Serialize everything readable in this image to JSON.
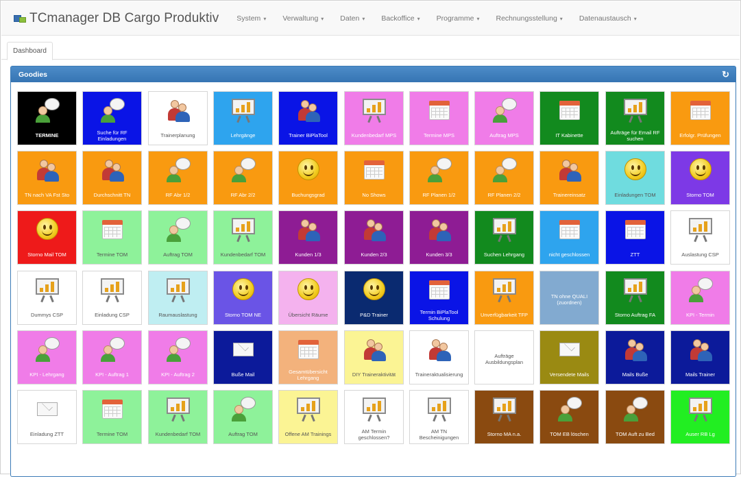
{
  "app": {
    "title": "TCmanager DB Cargo Produktiv"
  },
  "menu": [
    "System",
    "Verwaltung",
    "Daten",
    "Backoffice",
    "Programme",
    "Rechnungsstellung",
    "Datenaustausch"
  ],
  "tabs": [
    {
      "label": "Dashboard"
    }
  ],
  "panel": {
    "title": "Goodies"
  },
  "colors": {
    "black": "#000000",
    "blue": "#0a14e6",
    "white": "#ffffff",
    "sky": "#2ea4ee",
    "pink": "#f07ce8",
    "green": "#128a1e",
    "orange": "#f99a10",
    "teal": "#6fdcdf",
    "violet": "#7d39e6",
    "red": "#ee1a1a",
    "lightgreen": "#8ef29a",
    "purple": "#8e1c94",
    "navy": "#0d3a8c",
    "pale": "#bfeef2",
    "mid": "#6a54e6",
    "lightpink": "#f4b2ee",
    "darkblue": "#0a2a70",
    "deepnavy": "#0c1a9a",
    "peach": "#f3b27c",
    "yellow": "#fbf494",
    "olive": "#9a8a12",
    "brown": "#8a4a10",
    "lime": "#22ee22",
    "steel": "#82aad0"
  },
  "tiles": [
    [
      {
        "label": "TERMINE",
        "icon": "chat-icon",
        "bg": "#000000",
        "fg": "#ffffff",
        "bold": true
      },
      {
        "label": "Suche für RF Einladungen",
        "icon": "chat-icon",
        "bg": "#0a14e6",
        "fg": "#ffffff"
      },
      {
        "label": "Trainerplanung",
        "icon": "people-icon",
        "bg": "#ffffff",
        "fg": "#555555"
      },
      {
        "label": "Lehrgänge",
        "icon": "board-icon",
        "bg": "#2ea4ee",
        "fg": "#ffffff"
      },
      {
        "label": "Trainer BiPlaTool",
        "icon": "people-icon",
        "bg": "#0a14e6",
        "fg": "#ffffff"
      },
      {
        "label": "Kundenbedarf MPS",
        "icon": "board-icon",
        "bg": "#f07ce8",
        "fg": "#ffffff"
      },
      {
        "label": "Termine MPS",
        "icon": "calendar-icon",
        "bg": "#f07ce8",
        "fg": "#ffffff"
      },
      {
        "label": "Auftrag MPS",
        "icon": "chat-icon",
        "bg": "#f07ce8",
        "fg": "#ffffff"
      },
      {
        "label": "IT Kabinette",
        "icon": "calendar-icon",
        "bg": "#128a1e",
        "fg": "#ffffff"
      },
      {
        "label": "Aufträge für Email RF suchen",
        "icon": "board-icon",
        "bg": "#128a1e",
        "fg": "#ffffff"
      },
      {
        "label": "Erfolgr. Prüfungen",
        "icon": "calendar-icon",
        "bg": "#f99a10",
        "fg": "#ffffff"
      }
    ],
    [
      {
        "label": "TN nach VA Fst Sto",
        "icon": "people-icon",
        "bg": "#f99a10",
        "fg": "#ffffff"
      },
      {
        "label": "Durchschnitt TN",
        "icon": "people-icon",
        "bg": "#f99a10",
        "fg": "#ffffff"
      },
      {
        "label": "RF Abr 1/2",
        "icon": "chat-icon",
        "bg": "#f99a10",
        "fg": "#ffffff"
      },
      {
        "label": "RF Abr 2/2",
        "icon": "chat-icon",
        "bg": "#f99a10",
        "fg": "#ffffff"
      },
      {
        "label": "Buchungsgrad",
        "icon": "smile-icon",
        "bg": "#f99a10",
        "fg": "#ffffff"
      },
      {
        "label": "No Shows",
        "icon": "calendar-icon",
        "bg": "#f99a10",
        "fg": "#ffffff"
      },
      {
        "label": "RF Planen 1/2",
        "icon": "chat-icon",
        "bg": "#f99a10",
        "fg": "#ffffff"
      },
      {
        "label": "RF Planen 2/2",
        "icon": "chat-icon",
        "bg": "#f99a10",
        "fg": "#ffffff"
      },
      {
        "label": "Trainereinsatz",
        "icon": "people-icon",
        "bg": "#f99a10",
        "fg": "#ffffff"
      },
      {
        "label": "Einladungen TOM",
        "icon": "smile-icon",
        "bg": "#6fdcdf",
        "fg": "#555555"
      },
      {
        "label": "Storno TOM",
        "icon": "smile-icon",
        "bg": "#7d39e6",
        "fg": "#ffffff"
      }
    ],
    [
      {
        "label": "Storno Mail TOM",
        "icon": "smile-icon",
        "bg": "#ee1a1a",
        "fg": "#ffffff"
      },
      {
        "label": "Termine TOM",
        "icon": "calendar-icon",
        "bg": "#8ef29a",
        "fg": "#555555"
      },
      {
        "label": "Auftrag TOM",
        "icon": "chat-icon",
        "bg": "#8ef29a",
        "fg": "#555555"
      },
      {
        "label": "Kundenbedarf TOM",
        "icon": "board-icon",
        "bg": "#8ef29a",
        "fg": "#555555"
      },
      {
        "label": "Kunden 1/3",
        "icon": "people-icon",
        "bg": "#8e1c94",
        "fg": "#ffffff"
      },
      {
        "label": "Kunden 2/3",
        "icon": "people-icon",
        "bg": "#8e1c94",
        "fg": "#ffffff"
      },
      {
        "label": "Kunden 3/3",
        "icon": "people-icon",
        "bg": "#8e1c94",
        "fg": "#ffffff"
      },
      {
        "label": "Suchen Lehrgang",
        "icon": "board-icon",
        "bg": "#128a1e",
        "fg": "#ffffff"
      },
      {
        "label": "nicht geschlossen",
        "icon": "calendar-icon",
        "bg": "#2ea4ee",
        "fg": "#ffffff"
      },
      {
        "label": "ZTT",
        "icon": "calendar-icon",
        "bg": "#0a14e6",
        "fg": "#ffffff"
      },
      {
        "label": "Auslastung CSP",
        "icon": "board-icon",
        "bg": "#ffffff",
        "fg": "#555555"
      }
    ],
    [
      {
        "label": "Dummys CSP",
        "icon": "board-icon",
        "bg": "#ffffff",
        "fg": "#555555"
      },
      {
        "label": "Einladung CSP",
        "icon": "board-icon",
        "bg": "#ffffff",
        "fg": "#555555"
      },
      {
        "label": "Raumauslastung",
        "icon": "board-icon",
        "bg": "#bfeef2",
        "fg": "#555555"
      },
      {
        "label": "Storno TOM NE",
        "icon": "smile-icon",
        "bg": "#6a54e6",
        "fg": "#ffffff"
      },
      {
        "label": "Übersicht Räume",
        "icon": "smile-icon",
        "bg": "#f4b2ee",
        "fg": "#555555"
      },
      {
        "label": "P&D Trainer",
        "icon": "smile-icon",
        "bg": "#0a2a70",
        "fg": "#ffffff"
      },
      {
        "label": "Termin BiPlaTool Schulung",
        "icon": "calendar-icon",
        "bg": "#0a14e6",
        "fg": "#ffffff"
      },
      {
        "label": "Unverfügbarkeit TFP",
        "icon": "board-icon",
        "bg": "#f99a10",
        "fg": "#ffffff"
      },
      {
        "label": "TN ohne QUALI (zuordnen)",
        "icon": "",
        "bg": "#82aad0",
        "fg": "#ffffff"
      },
      {
        "label": "Storno Auftrag FA",
        "icon": "board-icon",
        "bg": "#128a1e",
        "fg": "#ffffff"
      },
      {
        "label": "KPI - Termin",
        "icon": "chat-icon",
        "bg": "#f07ce8",
        "fg": "#ffffff"
      }
    ],
    [
      {
        "label": "KPI - Lehrgang",
        "icon": "chat-icon",
        "bg": "#f07ce8",
        "fg": "#ffffff"
      },
      {
        "label": "KPI - Auftrag 1",
        "icon": "chat-icon",
        "bg": "#f07ce8",
        "fg": "#ffffff"
      },
      {
        "label": "KPI - Auftrag 2",
        "icon": "chat-icon",
        "bg": "#f07ce8",
        "fg": "#ffffff"
      },
      {
        "label": "Buße Mail",
        "icon": "mail-icon",
        "bg": "#0c1a9a",
        "fg": "#ffffff"
      },
      {
        "label": "Gesamtübersicht Lehrgang",
        "icon": "calendar-icon",
        "bg": "#f3b27c",
        "fg": "#ffffff"
      },
      {
        "label": "DIY Traineraktivität",
        "icon": "people-icon",
        "bg": "#fbf494",
        "fg": "#555555"
      },
      {
        "label": "Traineraktualisierung",
        "icon": "people-icon",
        "bg": "#ffffff",
        "fg": "#555555"
      },
      {
        "label": "Aufträge Ausbildungsplan",
        "icon": "",
        "bg": "#ffffff",
        "fg": "#555555"
      },
      {
        "label": "Versendete Mails",
        "icon": "mail-icon",
        "bg": "#9a8a12",
        "fg": "#ffffff"
      },
      {
        "label": "Mails Buße",
        "icon": "people-icon",
        "bg": "#0c1a9a",
        "fg": "#ffffff"
      },
      {
        "label": "Mails Trainer",
        "icon": "people-icon",
        "bg": "#0c1a9a",
        "fg": "#ffffff"
      }
    ],
    [
      {
        "label": "Einladung ZTT",
        "icon": "mail-icon",
        "bg": "#ffffff",
        "fg": "#555555"
      },
      {
        "label": "Termine TOM",
        "icon": "calendar-icon",
        "bg": "#8ef29a",
        "fg": "#555555"
      },
      {
        "label": "Kundenbedarf TOM",
        "icon": "board-icon",
        "bg": "#8ef29a",
        "fg": "#555555"
      },
      {
        "label": "Auftrag TOM",
        "icon": "chat-icon",
        "bg": "#8ef29a",
        "fg": "#555555"
      },
      {
        "label": "Offene AM Trainings",
        "icon": "board-icon",
        "bg": "#fbf494",
        "fg": "#555555"
      },
      {
        "label": "AM Termin geschlossen?",
        "icon": "board-icon",
        "bg": "#ffffff",
        "fg": "#555555"
      },
      {
        "label": "AM TN Bescheinigungen",
        "icon": "board-icon",
        "bg": "#ffffff",
        "fg": "#555555"
      },
      {
        "label": "Storno MA n.a.",
        "icon": "board-icon",
        "bg": "#8a4a10",
        "fg": "#ffffff"
      },
      {
        "label": "TOM EB löschen",
        "icon": "chat-icon",
        "bg": "#8a4a10",
        "fg": "#ffffff"
      },
      {
        "label": "TOM Auft zu Bed",
        "icon": "chat-icon",
        "bg": "#8a4a10",
        "fg": "#ffffff"
      },
      {
        "label": "Auser RB Lg",
        "icon": "board-icon",
        "bg": "#22ee22",
        "fg": "#ffffff"
      }
    ]
  ]
}
